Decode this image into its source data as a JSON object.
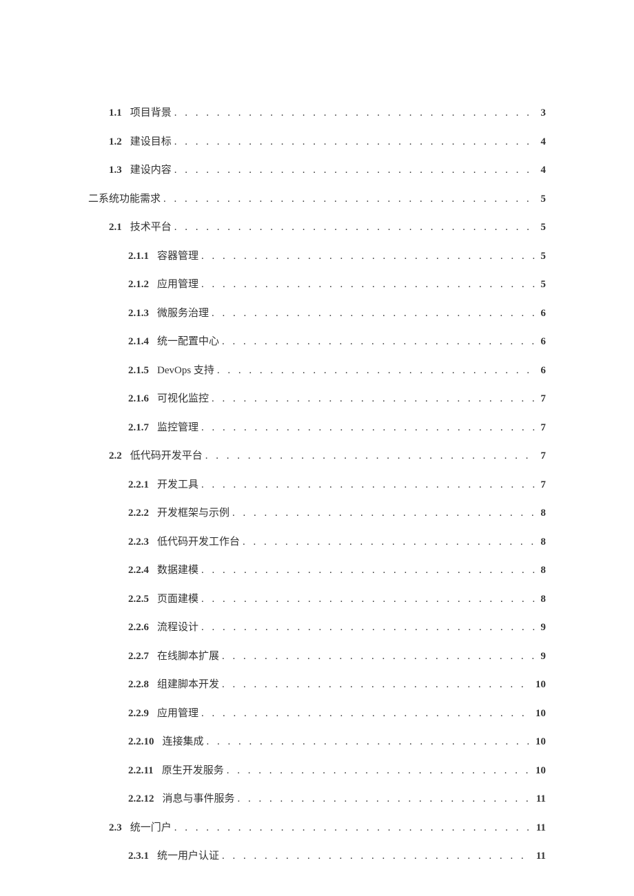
{
  "toc": {
    "leader": ". . . . . . . . . . . . . . . . . . . . . . . . . . . . . . . . . . . . . . . . . . . . . . . . . . . . . . . . . . . . . . . . . . . . . . . . . . . . . . . .",
    "entries": [
      {
        "level": 1,
        "number": "1.1",
        "title": "项目背景",
        "page": "3"
      },
      {
        "level": 1,
        "number": "1.2",
        "title": "建设目标",
        "page": "4"
      },
      {
        "level": 1,
        "number": "1.3",
        "title": "建设内容",
        "page": "4"
      },
      {
        "level": 0,
        "number": "",
        "title": "二系统功能需求",
        "page": "5"
      },
      {
        "level": 1,
        "number": "2.1",
        "title": "技术平台",
        "page": "5"
      },
      {
        "level": 2,
        "number": "2.1.1",
        "title": "容器管理",
        "page": "5"
      },
      {
        "level": 2,
        "number": "2.1.2",
        "title": "应用管理",
        "page": "5"
      },
      {
        "level": 2,
        "number": "2.1.3",
        "title": "微服务治理",
        "page": "6"
      },
      {
        "level": 2,
        "number": "2.1.4",
        "title": "统一配置中心",
        "page": "6"
      },
      {
        "level": 2,
        "number": "2.1.5",
        "title": "DevOps 支持",
        "page": "6"
      },
      {
        "level": 2,
        "number": "2.1.6",
        "title": "可视化监控",
        "page": "7"
      },
      {
        "level": 2,
        "number": "2.1.7",
        "title": "监控管理",
        "page": "7"
      },
      {
        "level": 1,
        "number": "2.2",
        "title": "低代码开发平台",
        "page": "7"
      },
      {
        "level": 2,
        "number": "2.2.1",
        "title": "开发工具",
        "page": "7"
      },
      {
        "level": 2,
        "number": "2.2.2",
        "title": "开发框架与示例",
        "page": "8"
      },
      {
        "level": 2,
        "number": "2.2.3",
        "title": "低代码开发工作台",
        "page": "8"
      },
      {
        "level": 2,
        "number": "2.2.4",
        "title": "数据建模",
        "page": "8"
      },
      {
        "level": 2,
        "number": "2.2.5",
        "title": "页面建模",
        "page": "8"
      },
      {
        "level": 2,
        "number": "2.2.6",
        "title": "流程设计",
        "page": "9"
      },
      {
        "level": 2,
        "number": "2.2.7",
        "title": "在线脚本扩展",
        "page": "9"
      },
      {
        "level": 2,
        "number": "2.2.8",
        "title": "组建脚本开发",
        "page": "10"
      },
      {
        "level": 2,
        "number": "2.2.9",
        "title": "应用管理",
        "page": "10"
      },
      {
        "level": 2,
        "number": "2.2.10",
        "title": "连接集成",
        "page": "10"
      },
      {
        "level": 2,
        "number": "2.2.11",
        "title": "原生开发服务",
        "page": "10"
      },
      {
        "level": 2,
        "number": "2.2.12",
        "title": "消息与事件服务",
        "page": "11"
      },
      {
        "level": 1,
        "number": "2.3",
        "title": "统一门户",
        "page": "11"
      },
      {
        "level": 2,
        "number": "2.3.1",
        "title": "统一用户认证",
        "page": "11"
      }
    ]
  }
}
